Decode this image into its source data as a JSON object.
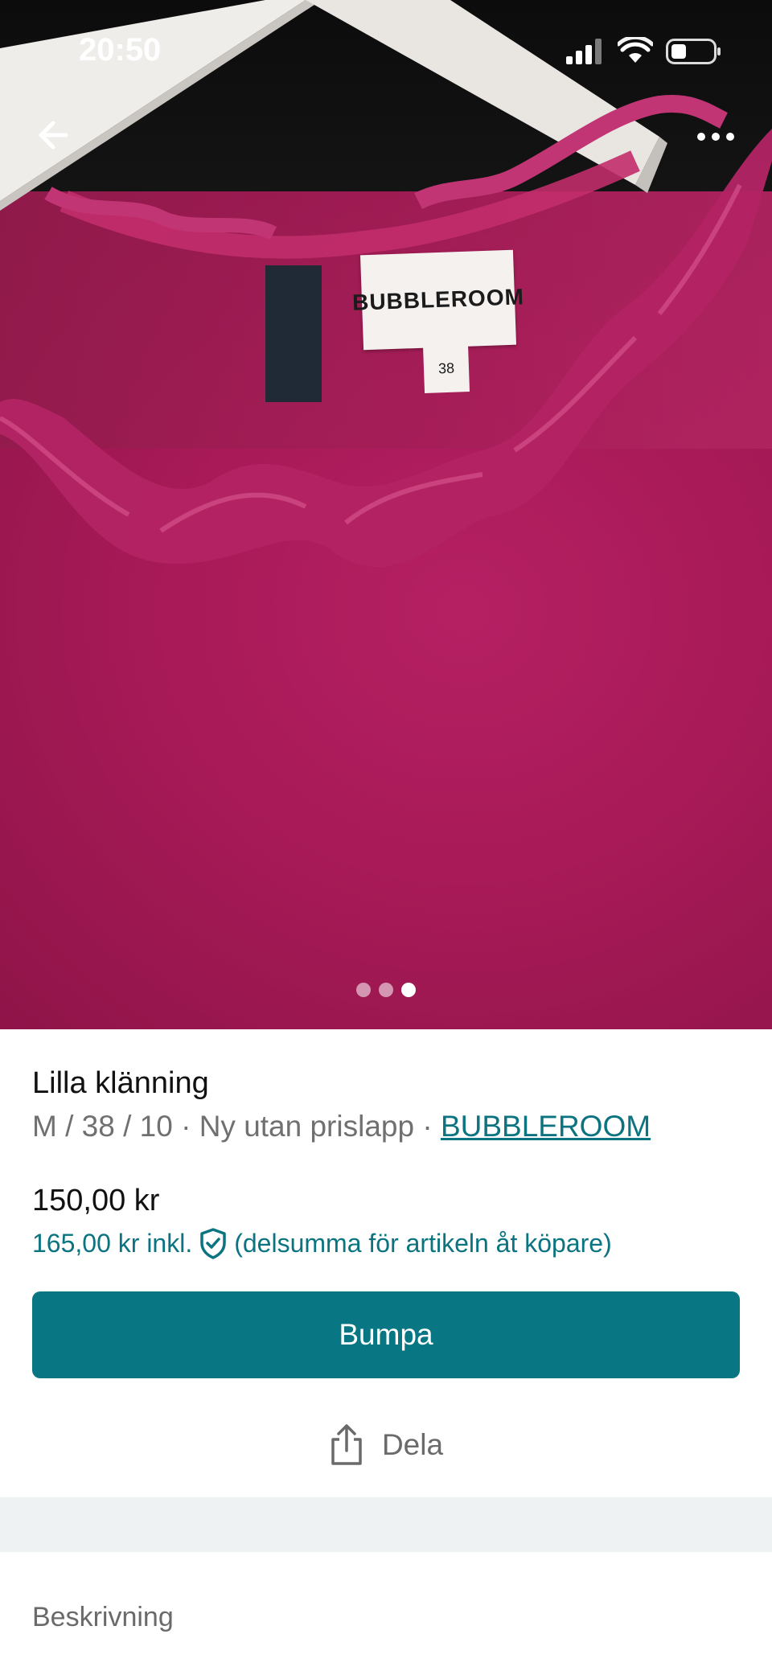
{
  "status_bar": {
    "time": "20:50"
  },
  "photo": {
    "brand_tag": "BUBBLEROOM",
    "size_tag": "38",
    "carousel": {
      "total": 3,
      "active_index": 3
    }
  },
  "listing": {
    "title": "Lilla klänning",
    "meta_prefix": "M / 38 / 10 · Ny utan prislapp · ",
    "brand": "BUBBLEROOM",
    "price": "150,00 kr",
    "price_incl": "165,00 kr inkl.",
    "price_incl_note": "(delsumma för artikeln åt köpare)"
  },
  "actions": {
    "bump_label": "Bumpa",
    "share_label": "Dela"
  },
  "description": {
    "label": "Beskrivning"
  },
  "colors": {
    "accent": "#097783",
    "link": "#0b7480",
    "dress": "#a81a58",
    "separator": "#eef2f2"
  }
}
